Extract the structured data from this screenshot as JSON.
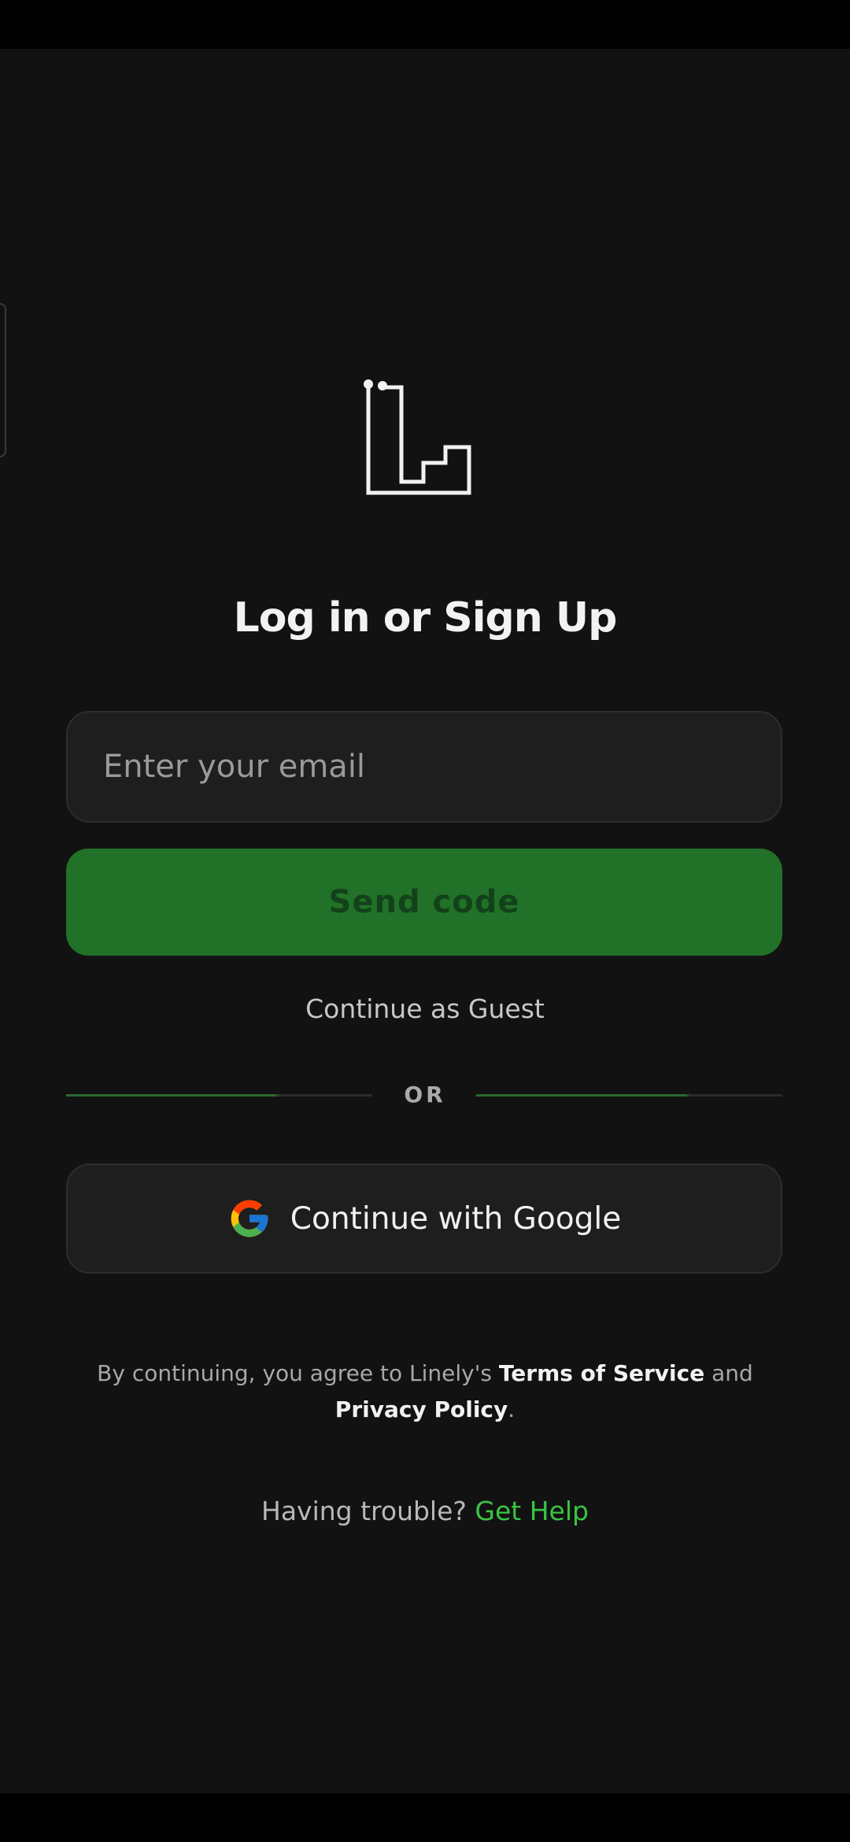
{
  "auth": {
    "title": "Log in or Sign Up",
    "email_placeholder": "Enter your email",
    "email_value": "",
    "send_code_label": "Send code",
    "guest_label": "Continue as Guest",
    "divider_label": "OR",
    "google_label": "Continue with Google"
  },
  "legal": {
    "prefix": "By continuing, you agree to Linely's",
    "terms_label": "Terms of Service",
    "and": "and",
    "privacy_label": "Privacy Policy",
    "suffix": "."
  },
  "help": {
    "question": "Having trouble?",
    "link_label": "Get Help"
  },
  "icons": {
    "logo": "linely-logo-icon",
    "google": "google-g-icon"
  },
  "colors": {
    "background": "#121212",
    "accent_green": "#227128",
    "help_link": "#39c443"
  }
}
